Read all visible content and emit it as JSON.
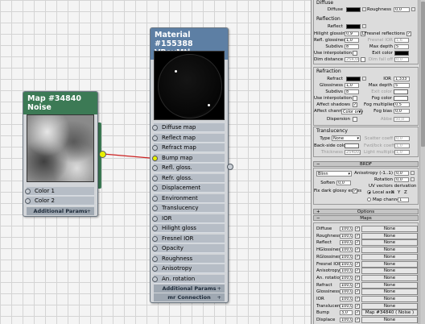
{
  "noise_node": {
    "title": "Map #34840\nNoise",
    "slots": [
      "Color 1",
      "Color 2"
    ],
    "rollout": "Additional Params"
  },
  "material_node": {
    "title": "Material #155388\nVRayMtl",
    "slots": [
      "Diffuse map",
      "Reflect map",
      "Refract map",
      "Bump map",
      "Refl. gloss.",
      "Refr. gloss.",
      "Displacement",
      "Environment",
      "Translucency",
      "IOR",
      "Hilight gloss",
      "Fresnel IOR",
      "Opacity",
      "Roughness",
      "Anisotropy",
      "An. rotation"
    ],
    "connected_slot": "Bump map",
    "rollouts": [
      "Additional Params",
      "mr Connection"
    ]
  },
  "basic": {
    "diffuse_group": "Diffuse",
    "diffuse": "Diffuse",
    "roughness": "Roughness",
    "roughness_val": "0,0",
    "reflection_group": "Reflection",
    "reflect": "Reflect",
    "hilight_gloss": "Hilight glossiness",
    "hilight_gloss_val": "0,9",
    "refl_gloss": "Refl. glossiness",
    "refl_gloss_val": "1,0",
    "subdivs": "Subdivs",
    "subdivs_val": "8",
    "use_interp": "Use interpolation",
    "dim_distance": "Dim distance",
    "dim_distance_val": "254,0c",
    "fresnel": "Fresnel reflections",
    "fresnel_ior": "Fresnel IOR",
    "fresnel_ior_val": "1,6",
    "max_depth": "Max depth",
    "max_depth_val": "5",
    "exit_color": "Exit color",
    "dim_falloff": "Dim fall off",
    "dim_falloff_val": "0,0",
    "lock": "L"
  },
  "refraction": {
    "group": "Refraction",
    "refract": "Refract",
    "ior": "IOR",
    "ior_val": "1,333",
    "glossiness": "Glossiness",
    "glossiness_val": "1,0",
    "max_depth": "Max depth",
    "max_depth_val": "5",
    "subdivs": "Subdivs",
    "subdivs_val": "8",
    "exit_color": "Exit color",
    "use_interp": "Use interpolation",
    "fog_color": "Fog color",
    "affect_shadows": "Affect shadows",
    "fog_mult": "Fog multiplier",
    "fog_mult_val": "0,5",
    "affect_channels": "Affect channels",
    "affect_channels_val": "Color only",
    "fog_bias": "Fog bias",
    "fog_bias_val": "0,0",
    "dispersion": "Dispersion",
    "abbe": "Abbe",
    "abbe_val": "50,0"
  },
  "translucency": {
    "group": "Translucency",
    "type": "Type",
    "type_val": "None",
    "scatter_coeff": "Scatter coeff",
    "scatter_val": "0,0",
    "backside_color": "Back-side color",
    "fwd_bck": "Fwd/bck coeff",
    "fwd_bck_val": "1,0",
    "thickness": "Thickness",
    "thickness_val": "25400,0",
    "light_mult": "Light multiplier",
    "light_mult_val": "1,0"
  },
  "brdf": {
    "header": "BRDF",
    "type_val": "Blinn",
    "anisotropy": "Anisotropy (-1..1)",
    "anisotropy_val": "0,0",
    "rotation": "Rotation",
    "rotation_val": "0,0",
    "soften": "Soften",
    "soften_val": "0,0",
    "fix_dark": "Fix dark glossy edges",
    "uv_deriv": "UV vectors derivation",
    "local_axis": "Local axis",
    "axes": [
      "X",
      "Y",
      "Z"
    ],
    "map_channel": "Map channel",
    "map_channel_val": "1"
  },
  "options_header": "Options",
  "maps": {
    "header": "Maps",
    "rows": [
      {
        "name": "Diffuse",
        "amount": "100,0",
        "map": "None"
      },
      {
        "name": "Roughness",
        "amount": "100,0",
        "map": "None"
      },
      {
        "name": "Reflect",
        "amount": "100,0",
        "map": "None"
      },
      {
        "name": "HGlossiness",
        "amount": "100,0",
        "map": "None"
      },
      {
        "name": "RGlossiness",
        "amount": "100,0",
        "map": "None"
      },
      {
        "name": "Fresnel IOR",
        "amount": "100,0",
        "map": "None"
      },
      {
        "name": "Anisotropy",
        "amount": "100,0",
        "map": "None"
      },
      {
        "name": "An. rotation",
        "amount": "100,0",
        "map": "None"
      },
      {
        "name": "Refract",
        "amount": "100,0",
        "map": "None"
      },
      {
        "name": "Glossiness",
        "amount": "100,0",
        "map": "None"
      },
      {
        "name": "IOR",
        "amount": "100,0",
        "map": "None"
      },
      {
        "name": "Translucent",
        "amount": "100,0",
        "map": "None"
      },
      {
        "name": "Bump",
        "amount": "3,0",
        "map": "Map #34840  ( Noise )"
      },
      {
        "name": "Displace",
        "amount": "100,0",
        "map": "None"
      },
      {
        "name": "Opacity",
        "amount": "100,0",
        "map": "None"
      }
    ]
  },
  "colors": {
    "noise_header": "#3c7a55",
    "material_header": "#5d7fa4",
    "wire": "#cc2222",
    "socket_highlight": "#e8f000",
    "diffuse_swatch": "#000000",
    "refract_swatch": "#000000",
    "exit_swatch": "#000000",
    "fog_swatch": "#ffffff",
    "backside_swatch": "#ffffff"
  }
}
